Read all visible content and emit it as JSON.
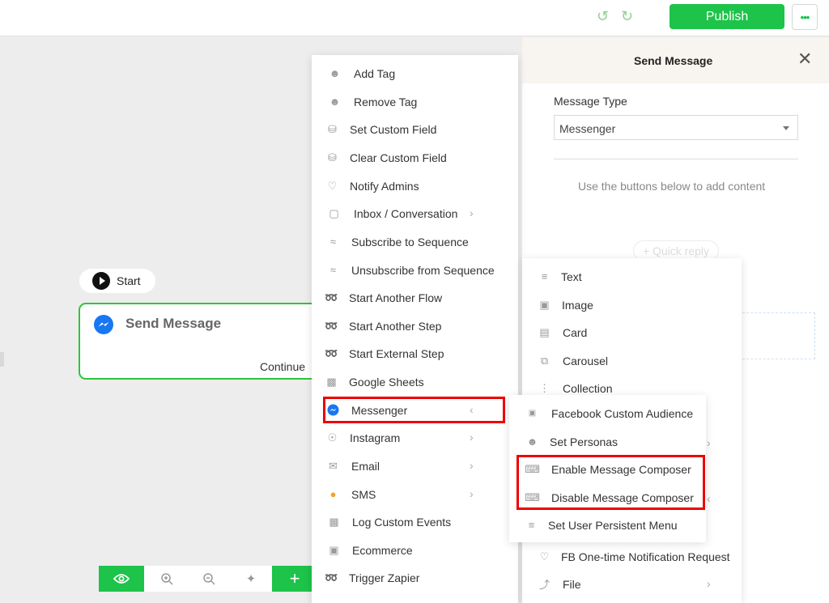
{
  "topbar": {
    "publish_label": "Publish",
    "more_label": "•••"
  },
  "canvas": {
    "start_label": "Start",
    "node_title": "Send Message",
    "node_continue": "Continue"
  },
  "panel": {
    "title": "Send Message",
    "message_type_label": "Message Type",
    "message_type_value": "Messenger",
    "hint": "Use the buttons below to add content",
    "quick_reply": "+ Quick reply"
  },
  "action_menu": {
    "items": [
      {
        "label": "Add Tag",
        "icon": "user-tag-icon"
      },
      {
        "label": "Remove Tag",
        "icon": "user-tag-icon"
      },
      {
        "label": "Set Custom Field",
        "icon": "database-icon"
      },
      {
        "label": "Clear Custom Field",
        "icon": "database-icon"
      },
      {
        "label": "Notify Admins",
        "icon": "bell-icon"
      },
      {
        "label": "Inbox / Conversation",
        "icon": "chat-icon"
      },
      {
        "label": "Subscribe to Sequence",
        "icon": "layers-icon"
      },
      {
        "label": "Unsubscribe from Sequence",
        "icon": "layers-icon"
      },
      {
        "label": "Start Another Flow",
        "icon": "bolt-icon"
      },
      {
        "label": "Start Another Step",
        "icon": "bolt-icon"
      },
      {
        "label": "Start External Step",
        "icon": "bolt-icon"
      },
      {
        "label": "Google Sheets",
        "icon": "sheet-icon"
      },
      {
        "label": "Messenger",
        "icon": "messenger-icon"
      },
      {
        "label": "Instagram",
        "icon": "instagram-icon"
      },
      {
        "label": "Email",
        "icon": "mail-icon"
      },
      {
        "label": "SMS",
        "icon": "sms-icon"
      },
      {
        "label": "Log Custom Events",
        "icon": "chart-icon"
      },
      {
        "label": "Ecommerce",
        "icon": "cart-icon"
      },
      {
        "label": "Trigger Zapier",
        "icon": "bolt-icon"
      }
    ]
  },
  "content_menu": {
    "items": [
      {
        "label": "Text",
        "icon": "text-icon"
      },
      {
        "label": "Image",
        "icon": "image-icon"
      },
      {
        "label": "Card",
        "icon": "card-icon"
      },
      {
        "label": "Carousel",
        "icon": "carousel-icon"
      },
      {
        "label": "Collection",
        "icon": "list-icon"
      },
      {
        "label": "FB One-time Notification Request",
        "icon": "bell-icon"
      },
      {
        "label": "File",
        "icon": "paperclip-icon"
      }
    ]
  },
  "messenger_submenu": {
    "items": [
      {
        "label": "Facebook Custom Audience",
        "icon": "ad-icon"
      },
      {
        "label": "Set Personas",
        "icon": "user-icon"
      },
      {
        "label": "Enable Message Composer",
        "icon": "keyboard-icon"
      },
      {
        "label": "Disable Message Composer",
        "icon": "keyboard-icon"
      },
      {
        "label": "Set User Persistent Menu",
        "icon": "menu-icon"
      }
    ]
  },
  "colors": {
    "brand_green": "#1ec34a",
    "highlight_red": "#ee0000",
    "messenger_blue": "#1877f2"
  }
}
